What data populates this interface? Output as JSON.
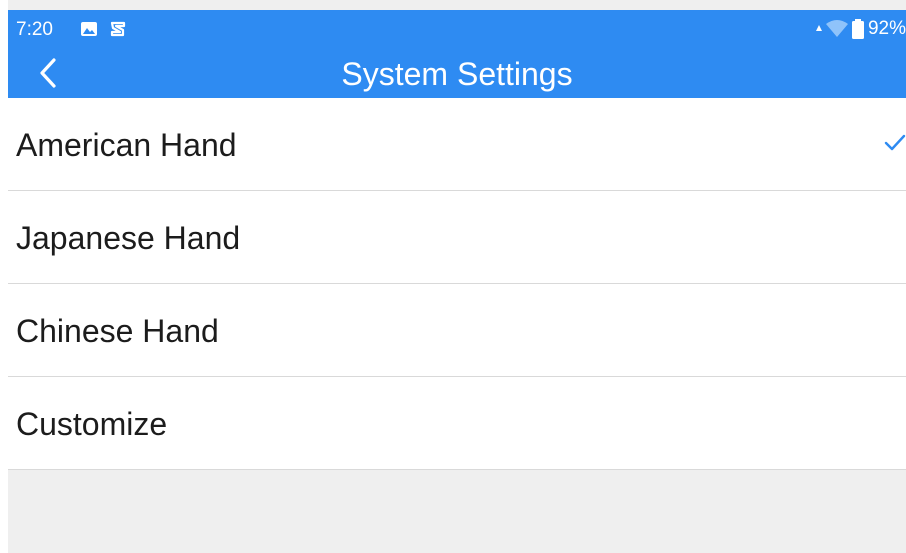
{
  "status_bar": {
    "time": "7:20",
    "battery_percent": "92%",
    "icons": [
      "gallery-icon",
      "app-notification-icon",
      "signal-arrow-icon",
      "wifi-icon",
      "battery-icon"
    ]
  },
  "header": {
    "title": "System Settings",
    "back_icon": "chevron-left-icon"
  },
  "options": [
    {
      "label": "American Hand",
      "selected": true
    },
    {
      "label": "Japanese Hand",
      "selected": false
    },
    {
      "label": "Chinese Hand",
      "selected": false
    },
    {
      "label": "Customize",
      "selected": false
    }
  ],
  "colors": {
    "header": "#2e8bf2",
    "check": "#2e8bf2",
    "background": "#efefef"
  }
}
